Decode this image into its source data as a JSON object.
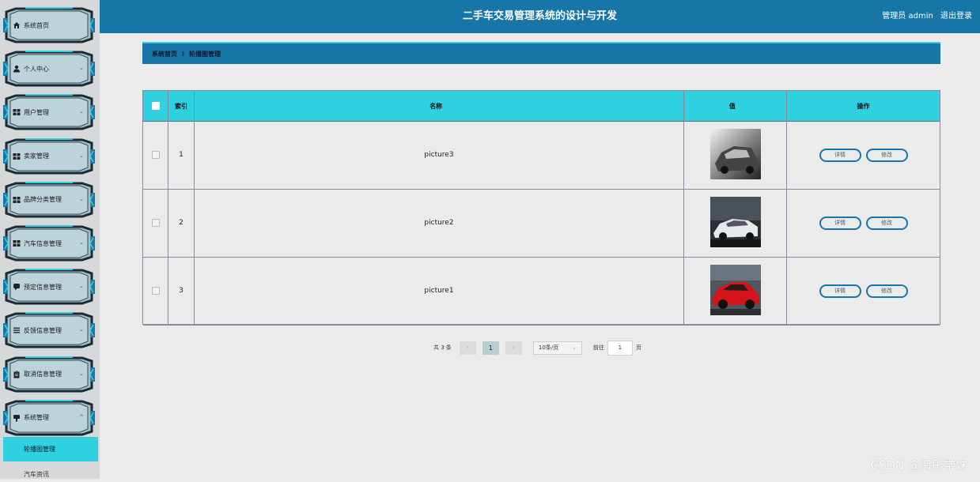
{
  "header": {
    "title": "二手车交易管理系统的设计与开发",
    "admin_text": "管理员 admin",
    "logout": "退出登录"
  },
  "sidebar": {
    "items": [
      {
        "label": "系统首页",
        "icon": "home-icon",
        "has_chevron": false
      },
      {
        "label": "个人中心",
        "icon": "user-icon",
        "has_chevron": true
      },
      {
        "label": "用户管理",
        "icon": "grid-icon",
        "has_chevron": true
      },
      {
        "label": "卖家管理",
        "icon": "grid-icon",
        "has_chevron": true
      },
      {
        "label": "品牌分类管理",
        "icon": "grid-icon",
        "has_chevron": true
      },
      {
        "label": "汽车信息管理",
        "icon": "grid-icon",
        "has_chevron": true
      },
      {
        "label": "预定信息管理",
        "icon": "chat-icon",
        "has_chevron": true
      },
      {
        "label": "反馈信息管理",
        "icon": "list-icon",
        "has_chevron": true
      },
      {
        "label": "取消信息管理",
        "icon": "clipboard-icon",
        "has_chevron": true
      },
      {
        "label": "系统管理",
        "icon": "cog-icon",
        "has_chevron": true
      }
    ],
    "sub_active": "轮播图管理",
    "sub_next": "汽车资讯"
  },
  "breadcrumb": {
    "home": "系统首页",
    "separator": "⁝",
    "current": "轮播图管理"
  },
  "table": {
    "headers": {
      "index": "索引",
      "name": "名称",
      "value": "值",
      "operation": "操作"
    },
    "rows": [
      {
        "index": "1",
        "name": "picture3",
        "image": "grey-car-image"
      },
      {
        "index": "2",
        "name": "picture2",
        "image": "white-car-image"
      },
      {
        "index": "3",
        "name": "picture1",
        "image": "red-car-image"
      }
    ],
    "detail_label": "详情",
    "edit_label": "修改"
  },
  "pagination": {
    "total_text": "共 3 条",
    "current_page": "1",
    "page_size": "10条/页",
    "goto_label": "前往",
    "goto_value": "1",
    "page_unit": "页"
  },
  "watermark": "CSDN @海彤学妹",
  "colors": {
    "header": "#1875a7",
    "accent": "#2fd0e0",
    "background": "#ebebeb"
  }
}
